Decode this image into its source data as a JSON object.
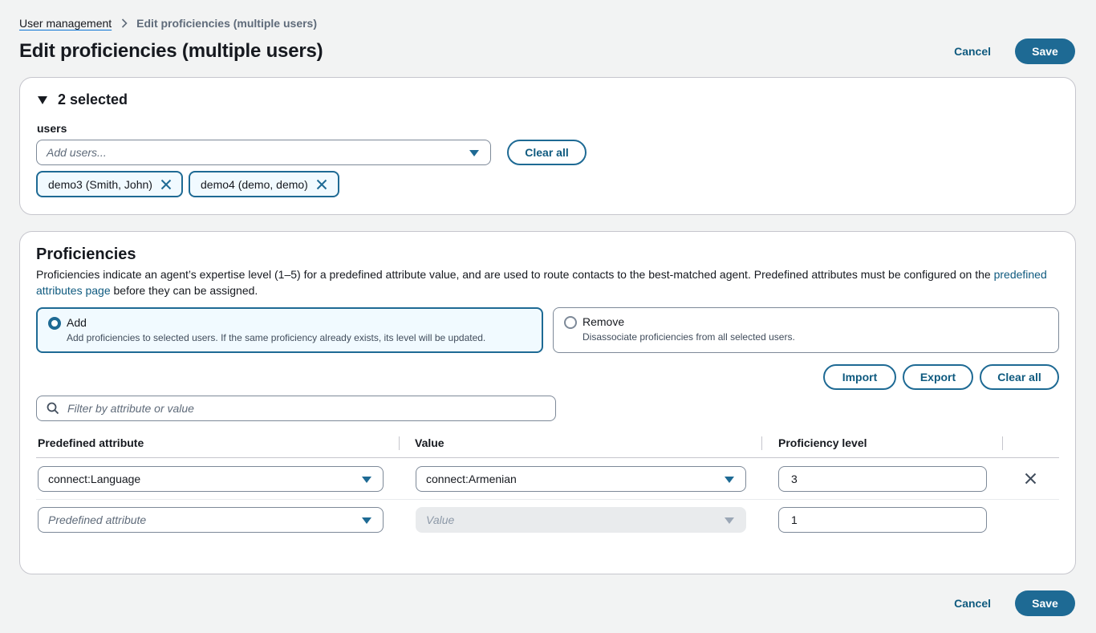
{
  "breadcrumb": {
    "parent": "User management",
    "current": "Edit proficiencies (multiple users)"
  },
  "page": {
    "title": "Edit proficiencies (multiple users)",
    "cancel_label": "Cancel",
    "save_label": "Save"
  },
  "selection": {
    "header": "2 selected",
    "users_label": "users",
    "placeholder": "Add users...",
    "clear_label": "Clear all",
    "tokens": [
      {
        "label": "demo3 (Smith, John)"
      },
      {
        "label": "demo4 (demo, demo)"
      }
    ]
  },
  "proficiencies": {
    "title": "Proficiencies",
    "description": "Proficiencies indicate an agent’s expertise level (1–5) for a predefined attribute value, and are used to route contacts to the best-matched agent. Predefined attributes must be configured on the",
    "link_text": "predefined attributes page",
    "description_tail": "before they can be assigned.",
    "mode": "add",
    "options": [
      {
        "title": "Add",
        "description": "Add proficiencies to selected users. If the same proficiency already exists, its level will be updated."
      },
      {
        "title": "Remove",
        "description": "Disassociate proficiencies from all selected users."
      }
    ],
    "buttons": {
      "import": "Import",
      "export": "Export",
      "clear_all": "Clear all"
    },
    "filter_placeholder": "Filter by attribute or value",
    "columns": [
      "Predefined attribute",
      "Value",
      "Proficiency level"
    ],
    "rows": [
      {
        "attribute": "connect:Language",
        "value": "connect:Armenian",
        "level": "3"
      },
      {
        "attribute_placeholder": "Predefined attribute",
        "value_placeholder": "Value",
        "level": "1"
      }
    ]
  },
  "colors": {
    "accent": "#1e6a94",
    "link": "#0f5a7f",
    "selected_bg": "#f1faff",
    "page_bg": "#f2f3f3"
  },
  "icons": [
    "chevron-right-icon",
    "caret-down-icon",
    "close-icon",
    "search-icon",
    "dropdown-arrow-icon"
  ]
}
